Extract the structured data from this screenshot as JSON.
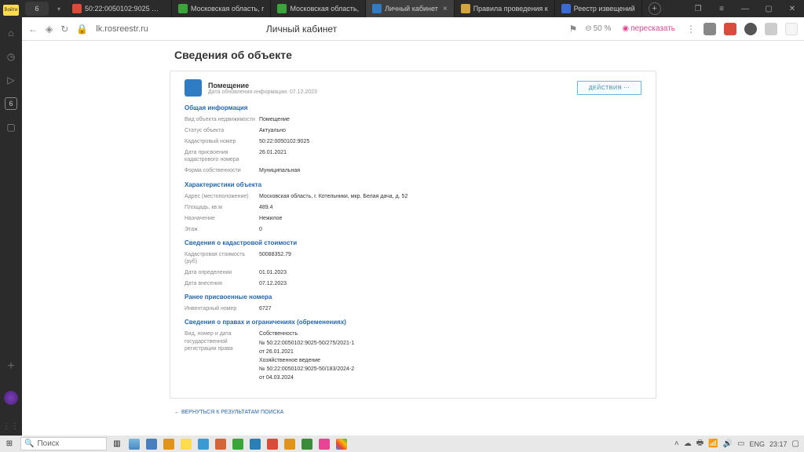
{
  "left_rail": {
    "login": "Войти",
    "badge": "6"
  },
  "tabs": {
    "count": "6",
    "items": [
      {
        "title": "50:22:0050102:9025 — ...",
        "color": "#d94b3a"
      },
      {
        "title": "Московская область, г",
        "color": "#3ba53b"
      },
      {
        "title": "Московская область,",
        "color": "#3ba53b"
      },
      {
        "title": "Личный кабинет",
        "color": "#2f7cc4",
        "active": true
      },
      {
        "title": "Правила проведения к",
        "color": "#d4a53a"
      },
      {
        "title": "Реестр извещений",
        "color": "#3a6bd4"
      }
    ]
  },
  "addr": {
    "url": "lk.rosreestr.ru",
    "title": "Личный кабинет",
    "zoom": "50 %",
    "retell": "пересказать"
  },
  "page": {
    "heading": "Сведения об объекте",
    "obj_title": "Помещение",
    "obj_sub": "Дата обновления информации: 07.12.2023",
    "action": "ДЕЙСТВИЯ  ⋯",
    "sections": {
      "general": {
        "title": "Общая информация",
        "rows": [
          {
            "label": "Вид объекта недвижимости",
            "value": "Помещение"
          },
          {
            "label": "Статус объекта",
            "value": "Актуально"
          },
          {
            "label": "Кадастровый номер",
            "value": "50:22:0050102:9025"
          },
          {
            "label": "Дата присвоения кадастрового номера",
            "value": "26.01.2021"
          },
          {
            "label": "Форма собственности",
            "value": "Муниципальная"
          }
        ]
      },
      "chars": {
        "title": "Характеристики объекта",
        "rows": [
          {
            "label": "Адрес (местоположение)",
            "value": "Московская область, г. Котельники, мкр. Белая дача, д. 52"
          },
          {
            "label": "Площадь, кв.м",
            "value": "489.4"
          },
          {
            "label": "Назначение",
            "value": "Нежилое"
          },
          {
            "label": "Этаж",
            "value": "0"
          }
        ]
      },
      "cost": {
        "title": "Сведения о кадастровой стоимости",
        "rows": [
          {
            "label": "Кадастровая стоимость (руб)",
            "value": "50088352.79"
          },
          {
            "label": "Дата определения",
            "value": "01.01.2023"
          },
          {
            "label": "Дата внесения",
            "value": "07.12.2023"
          }
        ]
      },
      "prev": {
        "title": "Ранее присвоенные номера",
        "rows": [
          {
            "label": "Инвентарный номер",
            "value": "6727"
          }
        ]
      },
      "rights": {
        "title": "Сведения о правах и ограничениях (обременениях)",
        "rows": [
          {
            "label": "Вид, номер и дата государственной регистрации права",
            "values": [
              "Собственность",
              "№ 50:22:0050102:9025-50/275/2021-1",
              "от 26.01.2021",
              "Хозяйственное ведение",
              "№ 50:22:0050102:9025-50/183/2024-2",
              "от 04.03.2024"
            ]
          }
        ]
      }
    },
    "back": "ВЕРНУТЬСЯ К РЕЗУЛЬТАТАМ ПОИСКА"
  },
  "taskbar": {
    "search": "Поиск",
    "lang": "ENG",
    "time": "23:17"
  }
}
